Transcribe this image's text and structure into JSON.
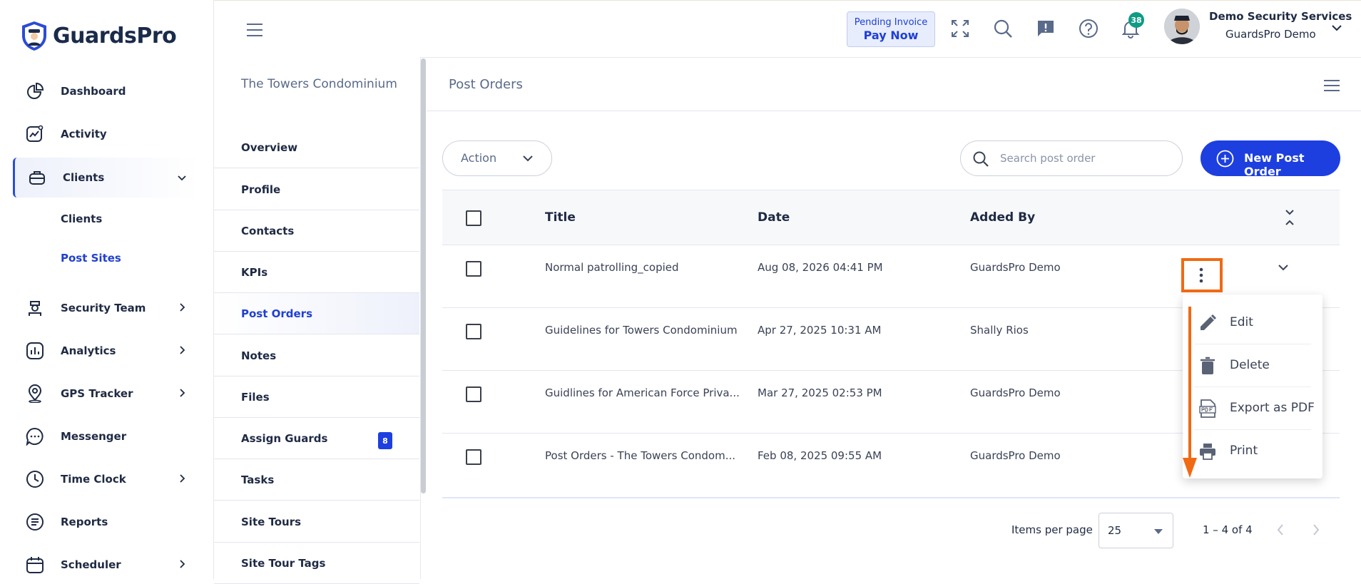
{
  "app": {
    "brand": "GuardsPro"
  },
  "sidebar": {
    "items": [
      {
        "label": "Dashboard"
      },
      {
        "label": "Activity"
      },
      {
        "label": "Clients"
      },
      {
        "label": "Security Team"
      },
      {
        "label": "Analytics"
      },
      {
        "label": "GPS Tracker"
      },
      {
        "label": "Messenger"
      },
      {
        "label": "Time Clock"
      },
      {
        "label": "Reports"
      },
      {
        "label": "Scheduler"
      }
    ],
    "clients_sub": [
      "Clients",
      "Post Sites"
    ]
  },
  "client_panel": {
    "title": "The Towers Condominium",
    "items": [
      "Overview",
      "Profile",
      "Contacts",
      "KPIs",
      "Post Orders",
      "Notes",
      "Files",
      "Assign Guards",
      "Tasks",
      "Site Tours",
      "Site Tour Tags"
    ],
    "assign_guards_badge": "8"
  },
  "header": {
    "pending_line1": "Pending Invoice",
    "pending_line2": "Pay Now",
    "notification_count": "38",
    "user_name": "Demo Security Services",
    "user_org": "GuardsPro Demo"
  },
  "main": {
    "title": "Post Orders",
    "action_label": "Action",
    "search_placeholder": "Search post order",
    "new_button": "New Post Order",
    "columns": [
      "Title",
      "Date",
      "Added By"
    ],
    "rows": [
      {
        "title": "Normal patrolling_copied",
        "date": "Aug 08, 2026 04:41 PM",
        "added_by": "GuardsPro Demo"
      },
      {
        "title": "Guidelines for Towers Condominium",
        "date": "Apr 27, 2025 10:31 AM",
        "added_by": "Shally Rios"
      },
      {
        "title": "Guidlines for American Force Priva...",
        "date": "Mar 27, 2025 02:53 PM",
        "added_by": "GuardsPro Demo"
      },
      {
        "title": "Post Orders - The Towers Condom...",
        "date": "Feb 08, 2025 09:55 AM",
        "added_by": "GuardsPro Demo"
      }
    ],
    "items_per_page_label": "Items per page",
    "items_per_page_value": "25",
    "range": "1 – 4 of 4"
  },
  "context_menu": {
    "items": [
      "Edit",
      "Delete",
      "Export as PDF",
      "Print"
    ]
  },
  "colors": {
    "primary": "#1d3fe0",
    "highlight": "#f06a13",
    "badge_green": "#0f9b86"
  }
}
